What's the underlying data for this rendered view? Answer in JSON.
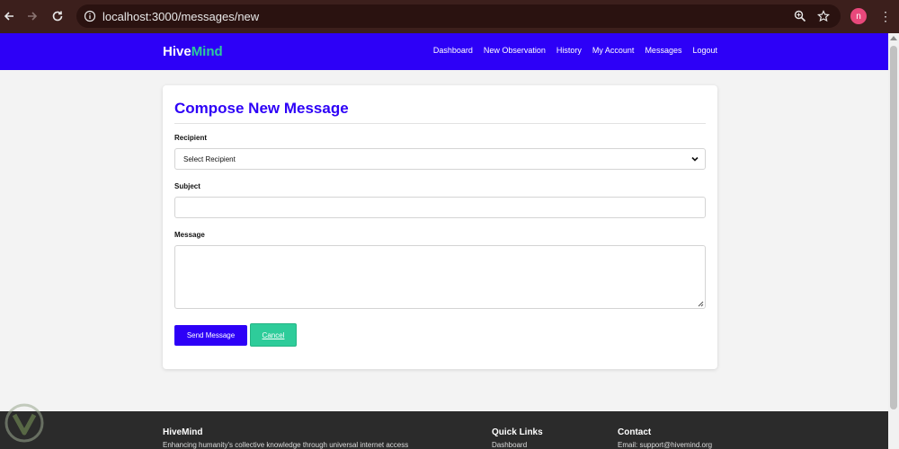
{
  "browser": {
    "url": "localhost:3000/messages/new",
    "profile_initial": "n"
  },
  "site": {
    "brand_main": "Hive",
    "brand_accent": "Mind",
    "nav": [
      "Dashboard",
      "New Observation",
      "History",
      "My Account",
      "Messages",
      "Logout"
    ]
  },
  "form": {
    "title": "Compose New Message",
    "recipient_label": "Recipient",
    "recipient_selected": "Select Recipient",
    "subject_label": "Subject",
    "subject_value": "",
    "message_label": "Message",
    "message_value": "",
    "send_label": "Send Message",
    "cancel_label": "Cancel"
  },
  "footer": {
    "col1_title": "HiveMind",
    "col1_text": "Enhancing humanity's collective knowledge through universal internet access",
    "col2_title": "Quick Links",
    "col2_text": "Dashboard",
    "col3_title": "Contact",
    "col3_text": "Email: support@hivemind.org"
  },
  "colors": {
    "brand_blue": "#2d00f7",
    "accent_green": "#2ecc9a",
    "chrome_bg": "#3c1f1c",
    "footer_bg": "#2b2b2b"
  },
  "icons": [
    "back-arrow-icon",
    "forward-arrow-icon",
    "reload-icon",
    "site-info-icon",
    "zoom-icon",
    "bookmark-star-icon",
    "menu-dots-icon",
    "chevron-down-icon"
  ]
}
